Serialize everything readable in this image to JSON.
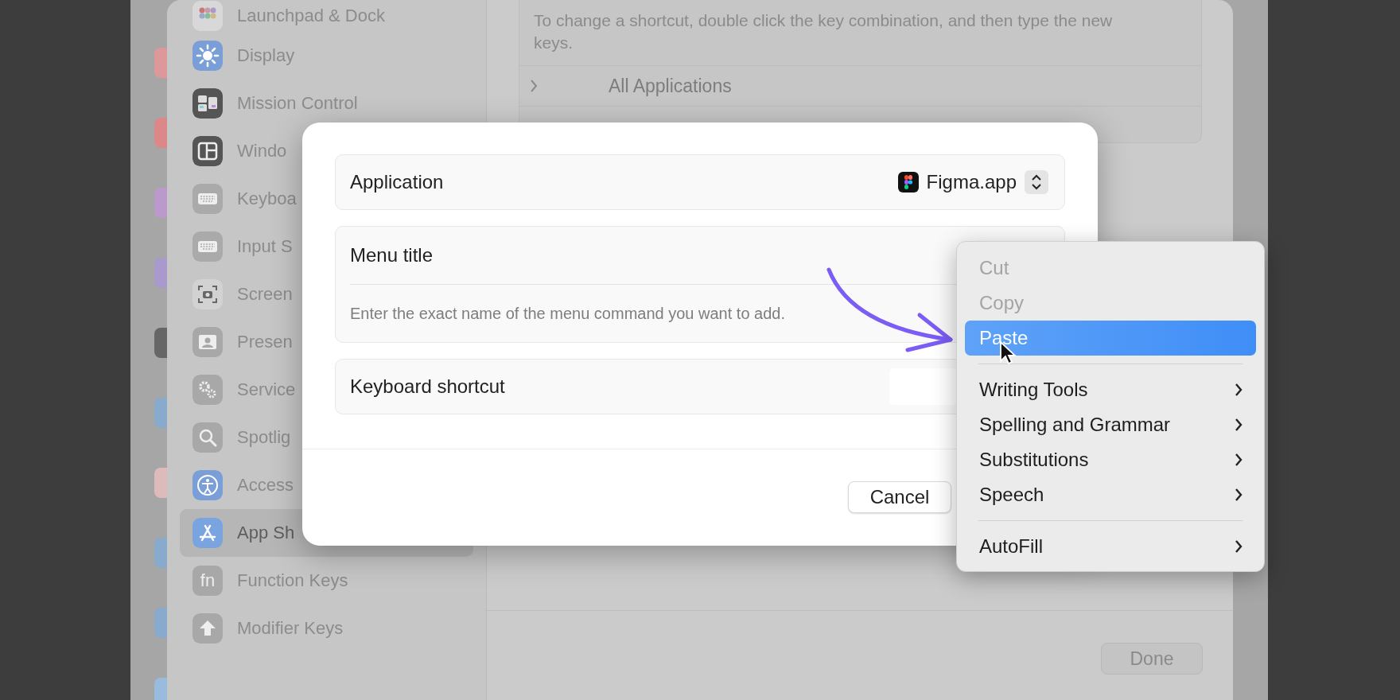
{
  "sidebar": {
    "items": [
      {
        "label": "Launchpad & Dock",
        "selected": false
      },
      {
        "label": "Display",
        "selected": false
      },
      {
        "label": "Mission Control",
        "selected": false
      },
      {
        "label": "Windo",
        "selected": false
      },
      {
        "label": "Keyboa",
        "selected": false
      },
      {
        "label": "Input S",
        "selected": false
      },
      {
        "label": "Screen",
        "selected": false
      },
      {
        "label": "Presen",
        "selected": false
      },
      {
        "label": "Service",
        "selected": false
      },
      {
        "label": "Spotlig",
        "selected": false
      },
      {
        "label": "Access",
        "selected": false
      },
      {
        "label": "App Sh",
        "selected": true
      },
      {
        "label": "Function Keys",
        "selected": false,
        "icon_text": "fn"
      },
      {
        "label": "Modifier Keys",
        "selected": false
      }
    ]
  },
  "shortcuts_pane": {
    "description": "To change a shortcut, double click the key combination, and then type the new keys.",
    "rows": [
      {
        "label": "All Applications",
        "expanded": false
      }
    ],
    "done_button": "Done"
  },
  "dialog": {
    "fields": [
      {
        "kind": "popup",
        "label": "Application",
        "value": "Figma.app"
      },
      {
        "kind": "text",
        "label": "Menu title",
        "placeholder": "Enter the exact name of the menu command you want to add."
      },
      {
        "kind": "shortcut",
        "label": "Keyboard shortcut"
      }
    ],
    "buttons": [
      "Cancel"
    ]
  },
  "context_menu": {
    "items": [
      {
        "kind": "item",
        "label": "Cut",
        "disabled": true,
        "selected": false,
        "submenu": false
      },
      {
        "kind": "item",
        "label": "Copy",
        "disabled": true,
        "selected": false,
        "submenu": false
      },
      {
        "kind": "item",
        "label": "Paste",
        "disabled": false,
        "selected": true,
        "submenu": false
      },
      {
        "kind": "separator"
      },
      {
        "kind": "item",
        "label": "Writing Tools",
        "disabled": false,
        "selected": false,
        "submenu": true
      },
      {
        "kind": "item",
        "label": "Spelling and Grammar",
        "disabled": false,
        "selected": false,
        "submenu": true
      },
      {
        "kind": "item",
        "label": "Substitutions",
        "disabled": false,
        "selected": false,
        "submenu": true
      },
      {
        "kind": "item",
        "label": "Speech",
        "disabled": false,
        "selected": false,
        "submenu": true
      },
      {
        "kind": "separator"
      },
      {
        "kind": "item",
        "label": "AutoFill",
        "disabled": false,
        "selected": false,
        "submenu": true
      }
    ]
  }
}
